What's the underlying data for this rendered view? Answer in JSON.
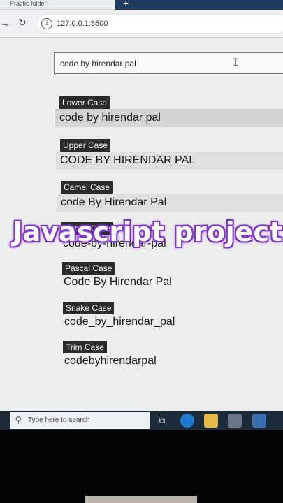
{
  "browser": {
    "tab_title": "Practic folder",
    "url": "127.0.0.1:5500"
  },
  "search": {
    "value": "code by hirendar pal"
  },
  "conversions": [
    {
      "label": "Lower Case",
      "output": "code by hirendar pal"
    },
    {
      "label": "Upper Case",
      "output": "CODE BY HIRENDAR PAL"
    },
    {
      "label": "Camel Case",
      "output": "code By Hirendar Pal"
    },
    {
      "label": "Kebab Case",
      "output": "code-by-hirendar-pal"
    },
    {
      "label": "Pascal Case",
      "output": "Code By Hirendar Pal"
    },
    {
      "label": "Snake Case",
      "output": "code_by_hirendar_pal"
    },
    {
      "label": "Trim Case",
      "output": "codebyhirendarpal"
    }
  ],
  "overlay_text": "Javascript project",
  "taskbar": {
    "search_placeholder": "Type here to search"
  },
  "colors": {
    "accent_overlay": "#8a3bd6",
    "label_bg": "#2b2b2b",
    "taskbar": "#1c2a3a"
  }
}
